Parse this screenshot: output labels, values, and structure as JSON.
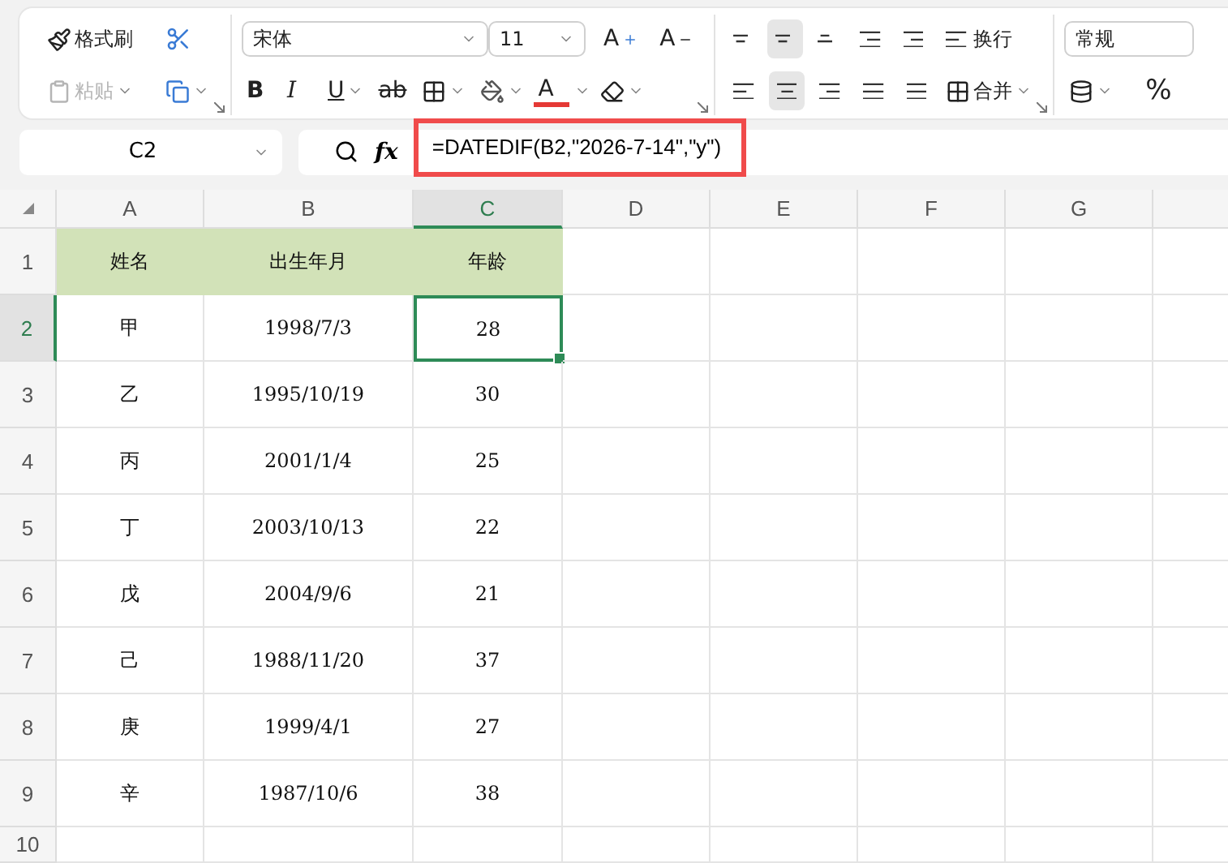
{
  "ribbon": {
    "clipboard": {
      "format_painter": "格式刷",
      "paste": {
        "label": "粘贴",
        "disabled": true
      }
    },
    "font": {
      "name": "宋体",
      "size": "11",
      "grow": "A",
      "shrink": "A",
      "styles": [
        {
          "kind": "bold",
          "label": "B"
        },
        {
          "kind": "italic",
          "label": "I"
        },
        {
          "kind": "underline",
          "label": "U"
        },
        {
          "kind": "strike",
          "label": "ab"
        }
      ],
      "font_color": "A"
    },
    "alignment": {
      "vertical": [
        {
          "kind": "top",
          "selected": false
        },
        {
          "kind": "middle",
          "selected": true
        },
        {
          "kind": "bottom",
          "selected": false
        }
      ],
      "horizontal": [
        {
          "kind": "left",
          "selected": false
        },
        {
          "kind": "center",
          "selected": true
        },
        {
          "kind": "right",
          "selected": false
        },
        {
          "kind": "justify",
          "selected": false
        }
      ],
      "wrap": "换行",
      "merge": "合并"
    },
    "number": {
      "format": "常规",
      "percent": "%"
    }
  },
  "formula_bar": {
    "cell_ref": "C2",
    "fx": "fx",
    "formula": "=DATEDIF(B2,\"2026-7-14\",\"y\")",
    "highlighted": true
  },
  "sheet": {
    "columns": [
      {
        "label": "A",
        "selected": false
      },
      {
        "label": "B",
        "selected": false
      },
      {
        "label": "C",
        "selected": true
      },
      {
        "label": "D",
        "selected": false
      },
      {
        "label": "E",
        "selected": false
      },
      {
        "label": "F",
        "selected": false
      },
      {
        "label": "G",
        "selected": false
      }
    ],
    "rows": [
      {
        "number": "1",
        "selected": false,
        "header": true,
        "cells": [
          {
            "text": "姓名",
            "active": false
          },
          {
            "text": "出生年月",
            "active": false
          },
          {
            "text": "年龄",
            "active": false
          }
        ]
      },
      {
        "number": "2",
        "selected": true,
        "header": false,
        "cells": [
          {
            "text": "甲",
            "active": false
          },
          {
            "text": "1998/7/3",
            "active": false
          },
          {
            "text": "28",
            "active": true
          }
        ]
      },
      {
        "number": "3",
        "selected": false,
        "header": false,
        "cells": [
          {
            "text": "乙",
            "active": false
          },
          {
            "text": "1995/10/19",
            "active": false
          },
          {
            "text": "30",
            "active": false
          }
        ]
      },
      {
        "number": "4",
        "selected": false,
        "header": false,
        "cells": [
          {
            "text": "丙",
            "active": false
          },
          {
            "text": "2001/1/4",
            "active": false
          },
          {
            "text": "25",
            "active": false
          }
        ]
      },
      {
        "number": "5",
        "selected": false,
        "header": false,
        "cells": [
          {
            "text": "丁",
            "active": false
          },
          {
            "text": "2003/10/13",
            "active": false
          },
          {
            "text": "22",
            "active": false
          }
        ]
      },
      {
        "number": "6",
        "selected": false,
        "header": false,
        "cells": [
          {
            "text": "戊",
            "active": false
          },
          {
            "text": "2004/9/6",
            "active": false
          },
          {
            "text": "21",
            "active": false
          }
        ]
      },
      {
        "number": "7",
        "selected": false,
        "header": false,
        "cells": [
          {
            "text": "己",
            "active": false
          },
          {
            "text": "1988/11/20",
            "active": false
          },
          {
            "text": "37",
            "active": false
          }
        ]
      },
      {
        "number": "8",
        "selected": false,
        "header": false,
        "cells": [
          {
            "text": "庚",
            "active": false
          },
          {
            "text": "1999/4/1",
            "active": false
          },
          {
            "text": "27",
            "active": false
          }
        ]
      },
      {
        "number": "9",
        "selected": false,
        "header": false,
        "cells": [
          {
            "text": "辛",
            "active": false
          },
          {
            "text": "1987/10/6",
            "active": false
          },
          {
            "text": "38",
            "active": false
          }
        ]
      },
      {
        "number": "10",
        "selected": false,
        "header": false,
        "cells": []
      }
    ]
  }
}
